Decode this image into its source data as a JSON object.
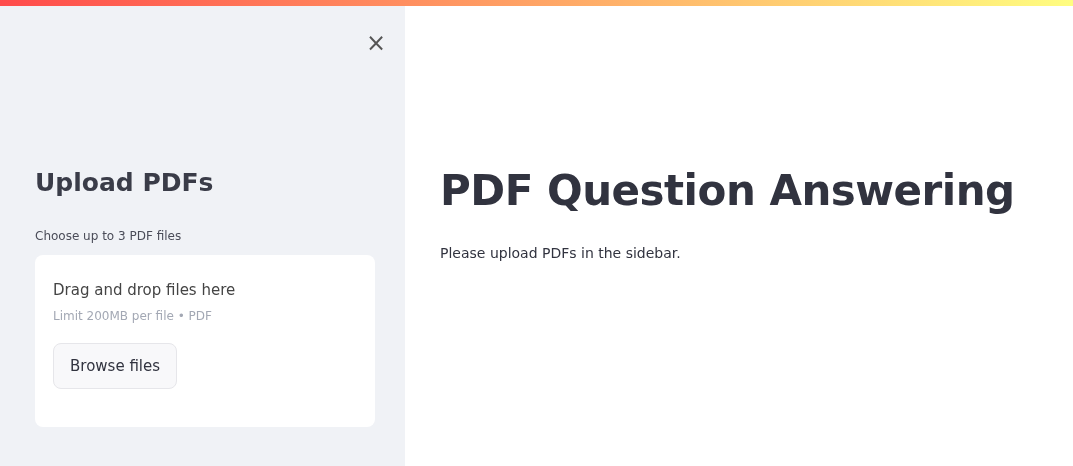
{
  "sidebar": {
    "close_label": "×",
    "title": "Upload PDFs",
    "uploader": {
      "label": "Choose up to 3 PDF files",
      "drop_text": "Drag and drop files here",
      "limit_text": "Limit 200MB per file • PDF",
      "button": "Browse files"
    }
  },
  "main": {
    "title": "PDF Question Answering",
    "message": "Please upload PDFs in the sidebar."
  }
}
